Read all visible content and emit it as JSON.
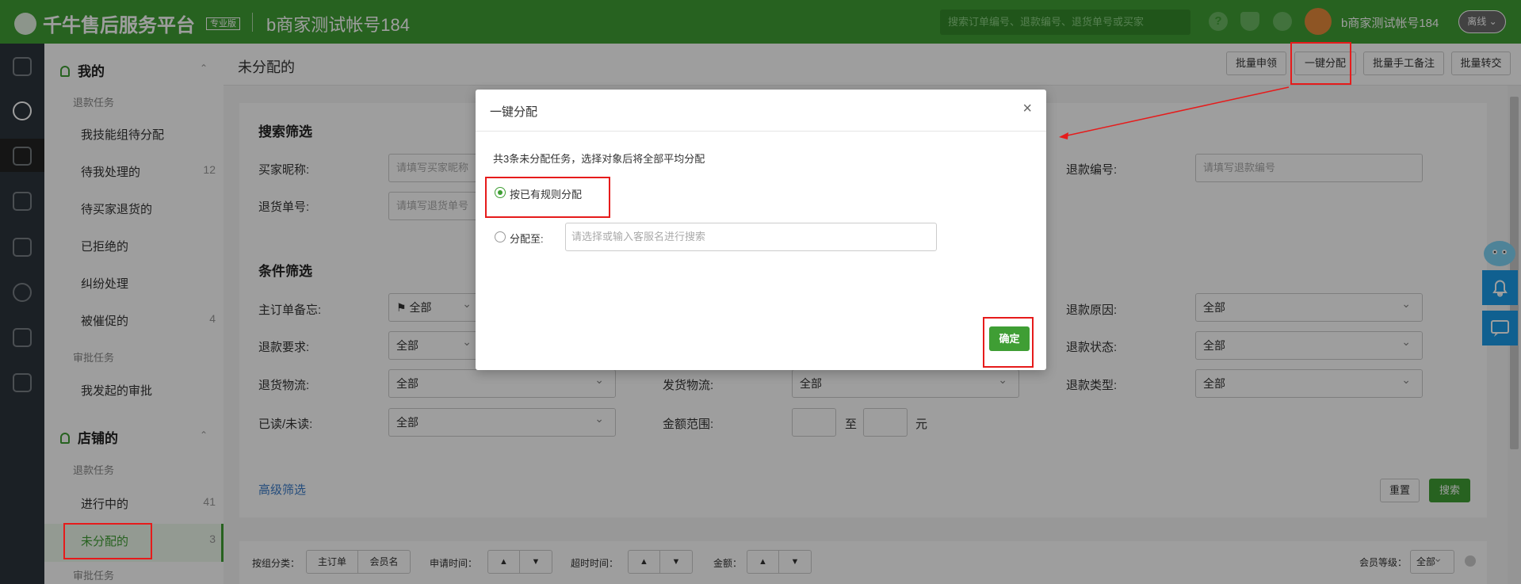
{
  "topbar": {
    "logo_text": "千牛售后服务平台",
    "edition_badge": "专业版",
    "account_title": "b商家测试帐号184",
    "search_placeholder": "搜索订单编号、退款编号、退货单号或买家",
    "help_icon": "?",
    "user_name": "b商家测试帐号184",
    "status": "离线"
  },
  "rail_icons": [
    "home-icon",
    "yuan-icon",
    "rocket-icon",
    "list-icon",
    "ticket-icon",
    "compass-icon",
    "users-icon",
    "calendar-icon"
  ],
  "sidebar": {
    "mine_title": "我的",
    "mine_sub_refund": "退款任务",
    "mine_items": [
      {
        "label": "我技能组待分配",
        "count": ""
      },
      {
        "label": "待我处理的",
        "count": "12"
      },
      {
        "label": "待买家退货的",
        "count": ""
      },
      {
        "label": "已拒绝的",
        "count": ""
      },
      {
        "label": "纠纷处理",
        "count": ""
      },
      {
        "label": "被催促的",
        "count": "4"
      }
    ],
    "mine_sub_approval": "审批任务",
    "mine_approval_item": "我发起的审批",
    "shop_title": "店铺的",
    "shop_sub_refund": "退款任务",
    "shop_items": [
      {
        "label": "进行中的",
        "count": "41"
      },
      {
        "label": "未分配的",
        "count": "3"
      }
    ],
    "shop_sub_approval": "审批任务"
  },
  "main": {
    "page_title": "未分配的",
    "actions": [
      "批量申领",
      "一键分配",
      "批量手工备注",
      "批量转交"
    ]
  },
  "search": {
    "title": "搜索筛选",
    "buyer_label": "买家昵称:",
    "buyer_placeholder": "请填写买家昵称",
    "return_label": "退货单号:",
    "return_placeholder": "请填写退货单号",
    "refund_no_label": "退款编号:",
    "refund_no_placeholder": "请填写退款编号"
  },
  "conditions": {
    "title": "条件筛选",
    "order_memo_label": "主订单备忘:",
    "order_memo_value": "全部",
    "refund_req_label": "退款要求:",
    "refund_req_value": "全部",
    "return_logistics_label": "退货物流:",
    "return_logistics_value": "全部",
    "ship_logistics_label": "发货物流:",
    "ship_logistics_value": "全部",
    "read_label": "已读/未读:",
    "read_value": "全部",
    "amount_label": "金额范围:",
    "amount_to": "至",
    "amount_unit": "元",
    "refund_reason_label": "退款原因:",
    "refund_reason_value": "全部",
    "refund_status_label": "退款状态:",
    "refund_status_value": "全部",
    "refund_type_label": "退款类型:",
    "refund_type_value": "全部",
    "advanced_link": "高级筛选",
    "reset": "重置",
    "search": "搜索"
  },
  "sortbar": {
    "group_label": "按组分类：",
    "group_options": [
      "主订单",
      "会员名"
    ],
    "apply_time_label": "申请时间：",
    "timeout_label": "超时时间：",
    "amount_label": "金额：",
    "member_level_label": "会员等级：",
    "member_level_value": "全部"
  },
  "modal": {
    "title": "一键分配",
    "close": "×",
    "description": "共3条未分配任务，选择对象后将全部平均分配",
    "option_rule": "按已有规则分配",
    "option_assign": "分配至:",
    "assign_placeholder": "请选择或输入客服名进行搜索",
    "confirm": "确定"
  },
  "colors": {
    "brand_green": "#3f9e34",
    "annotation_red": "#e61b1b",
    "float_blue": "#1a9be8"
  }
}
